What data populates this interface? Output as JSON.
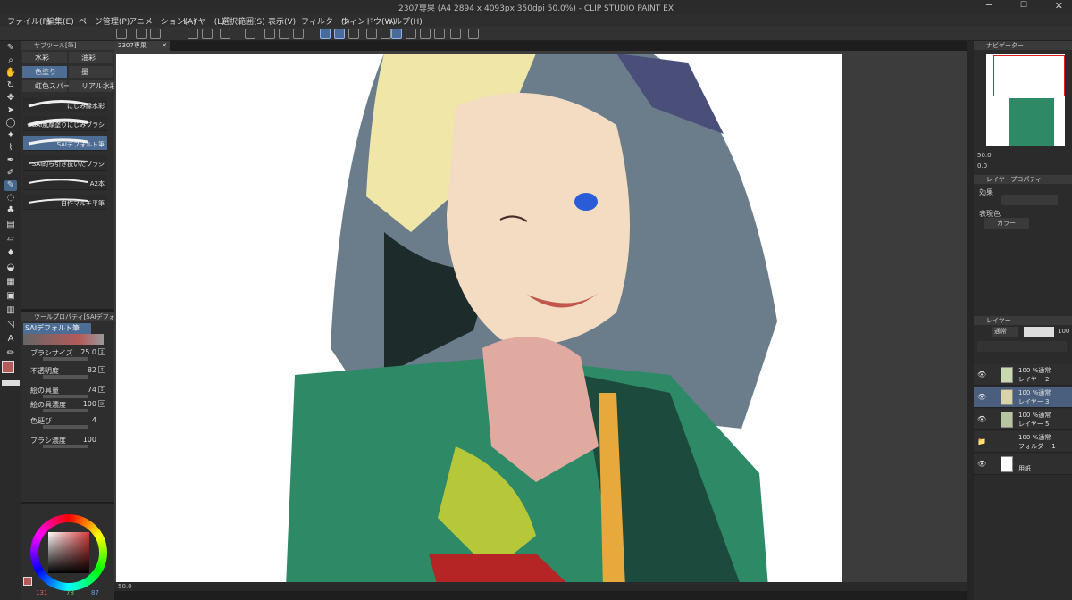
{
  "window": {
    "title": "2307専果 (A4 2894 x 4093px 350dpi 50.0%) - CLIP STUDIO PAINT EX"
  },
  "menu": [
    "ファイル(F)",
    "編集(E)",
    "ページ管理(P)",
    "アニメーション(A)",
    "レイヤー(L)",
    "選択範囲(S)",
    "表示(V)",
    "フィルター(I)",
    "ウィンドウ(W)",
    "ヘルプ(H)"
  ],
  "document": {
    "tab": "2307専果"
  },
  "subtool": {
    "header": "サブツール[筆]",
    "tabs": [
      "水彩",
      "油彩",
      "色塗り",
      "墨",
      "虹色スパー",
      "リアル水彩"
    ],
    "brushes": [
      "にじみ縁水彩",
      "★SAI風厚塗りにじみブラシ",
      "SAIデフォルト筆",
      "SAI的ら引き抜いたブラシ",
      "A2本",
      "自作マルチ平筆"
    ]
  },
  "toolprop": {
    "header": "ツールプロパティ[SAIデフォル",
    "name": "SAIデフォルト筆",
    "rows": [
      {
        "label": "ブラシサイズ",
        "value": "25.0"
      },
      {
        "label": "不透明度",
        "value": "82"
      },
      {
        "label": "絵の具量",
        "value": "74"
      },
      {
        "label": "絵の具濃度",
        "value": "100"
      },
      {
        "label": "色延び",
        "value": "4"
      },
      {
        "label": "ブラシ濃度",
        "value": "100"
      }
    ]
  },
  "color": {
    "main": "#b55a5a",
    "sub": "#ffffff",
    "r": "131",
    "g": "78",
    "b": "87"
  },
  "navigator": {
    "header": "ナビゲーター",
    "zoom": "50.0",
    "angle": "0.0"
  },
  "layerprop": {
    "header": "レイヤープロパティ",
    "effect": "効果",
    "express": "表現色",
    "color_mode": "カラー"
  },
  "layers": {
    "header": "レイヤー",
    "blend": "通常",
    "opacity": "100",
    "items": [
      {
        "mode": "100 %通常",
        "name": "レイヤー 2"
      },
      {
        "mode": "100 %通常",
        "name": "レイヤー 3"
      },
      {
        "mode": "100 %通常",
        "name": "レイヤー 5"
      },
      {
        "mode": "100 %通常",
        "name": "フォルダー 1"
      },
      {
        "mode": "",
        "name": "用紙"
      }
    ]
  },
  "status": {
    "zoom": "50.0"
  }
}
